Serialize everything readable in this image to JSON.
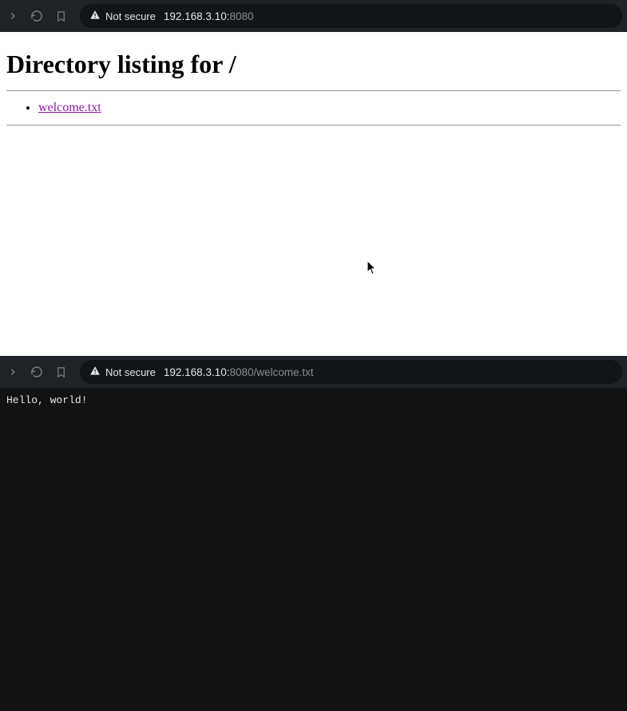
{
  "top": {
    "toolbar": {
      "security_label": "Not secure",
      "url_host": "192.168.3.10:",
      "url_port": "8080"
    },
    "page": {
      "title": "Directory listing for /",
      "files": [
        {
          "name": "welcome.txt"
        }
      ]
    }
  },
  "bottom": {
    "toolbar": {
      "security_label": "Not secure",
      "url_host": "192.168.3.10:",
      "url_port": "8080",
      "url_path": "/welcome.txt"
    },
    "page": {
      "content": "Hello, world!"
    }
  }
}
